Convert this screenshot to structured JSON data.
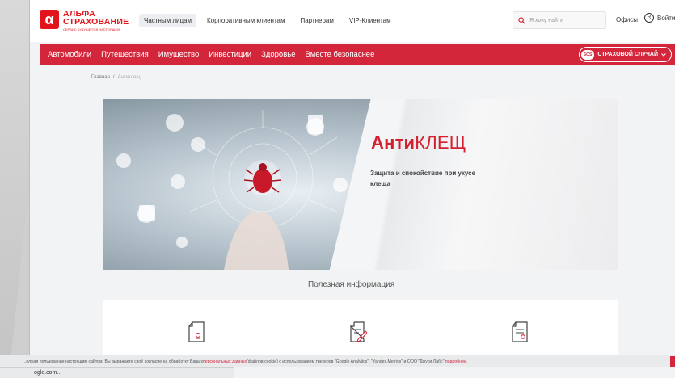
{
  "brand": {
    "mark": "α",
    "line1": "АЛЬФА",
    "line2": "СТРАХОВАНИЕ",
    "tagline": "СЕРВИС БУДУЩЕГО В НАСТОЯЩЕМ",
    "color": "#e2141b"
  },
  "topnav": [
    {
      "label": "Частным лицам",
      "active": true
    },
    {
      "label": "Корпоративным клиентам",
      "active": false
    },
    {
      "label": "Партнерам",
      "active": false
    },
    {
      "label": "VIP-Клиентам",
      "active": false
    }
  ],
  "search": {
    "placeholder": "Я хочу найти"
  },
  "header_links": {
    "offices": "Офисы",
    "login": "Войти",
    "login_badge": "R"
  },
  "mainnav": [
    "Автомобили",
    "Путешествия",
    "Имущество",
    "Инвестиции",
    "Здоровье",
    "Вместе безопаснее"
  ],
  "sos": {
    "badge": "SOS",
    "label": "СТРАХОВОЙ СЛУЧАЙ"
  },
  "breadcrumb": {
    "home": "Главная",
    "separator": "/",
    "current": "Антиклещ"
  },
  "hero": {
    "title_bold": "Анти",
    "title_rest": "КЛЕЩ",
    "subtitle": "Защита и спокойствие при укусе клеща"
  },
  "section": {
    "title": "Полезная информация"
  },
  "cookie": {
    "text_before": "...олжая пользование настоящим сайтом, Вы выражаете своё согласие на обработку Ваших ",
    "link1": "персональных данных",
    "text_after": " (файлов cookie) с использованием трекеров \"Google Analytics\", \"Yandex.Metrics\" и ООО \"Джуси Лабс\". ",
    "link2": "подробнее."
  },
  "status_bar": "ogle.com...",
  "colors": {
    "accent": "#d3263a",
    "brand": "#e2141b"
  }
}
